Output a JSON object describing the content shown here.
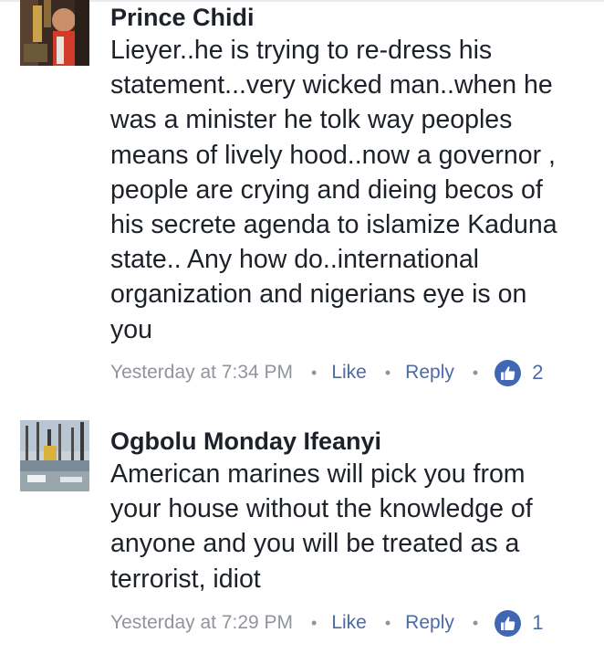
{
  "comments": [
    {
      "author": "Prince Chidi",
      "text": "Lieyer..he is trying to re-dress his\nstatement...very wicked man..when he\nwas a minister he tolk way peoples\nmeans of lively hood..now a governor ,\npeople are crying and dieing becos of\nhis secrete agenda to islamize Kaduna\nstate.. Any how do..international\norganization and nigerians eye is on\nyou",
      "timestamp": "Yesterday at 7:34 PM",
      "like_label": "Like",
      "reply_label": "Reply",
      "reaction_icon": "thumbs-up-icon",
      "reaction_count": "2"
    },
    {
      "author": "Ogbolu Monday Ifeanyi",
      "text": "American marines will pick you from\nyour house without the knowledge of\nanyone and you will be treated as a\nterrorist, idiot",
      "timestamp": "Yesterday at 7:29 PM",
      "like_label": "Like",
      "reply_label": "Reply",
      "reaction_icon": "thumbs-up-icon",
      "reaction_count": "1"
    }
  ],
  "separator": "•",
  "colors": {
    "author": "#1d2129",
    "text": "#1d2129",
    "meta": "#90949c",
    "action": "#4b6aa8",
    "like_badge": "#4267b2"
  }
}
